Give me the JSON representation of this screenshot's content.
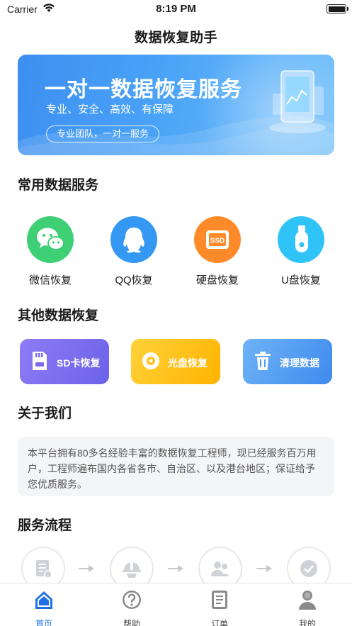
{
  "status_bar": {
    "carrier": "Carrier",
    "time": "8:19 PM"
  },
  "nav": {
    "title": "数据恢复助手"
  },
  "banner": {
    "title": "一对一数据恢复服务",
    "subtitle": "专业、安全、高效、有保障",
    "pill": "专业团队，一对一服务"
  },
  "common_services": {
    "title": "常用数据服务",
    "items": [
      {
        "label": "微信恢复",
        "icon": "wechat-icon",
        "color": "#3fcf75"
      },
      {
        "label": "QQ恢复",
        "icon": "qq-icon",
        "color": "#3598f3"
      },
      {
        "label": "硬盘恢复",
        "icon": "ssd-icon",
        "color": "#ff8a2a"
      },
      {
        "label": "U盘恢复",
        "icon": "usb-drive-icon",
        "color": "#2fc3f7"
      }
    ]
  },
  "other_recovery": {
    "title": "其他数据恢复",
    "items": [
      {
        "label": "SD卡恢复",
        "icon": "sd-card-icon",
        "color": "#7b6bf0"
      },
      {
        "label": "光盘恢复",
        "icon": "disc-icon",
        "color": "#ffc21a"
      },
      {
        "label": "清理数据",
        "icon": "trash-icon",
        "color": "#4f9af2"
      }
    ]
  },
  "about": {
    "title": "关于我们",
    "text": "本平台拥有80多名经验丰富的数据恢复工程师，现已经服务百万用户，工程师遍布国内各省各市、自治区、以及港台地区；保证给予您优质服务。"
  },
  "process": {
    "title": "服务流程",
    "steps": [
      {
        "icon": "order-form-icon"
      },
      {
        "icon": "engineer-icon"
      },
      {
        "icon": "customer-service-icon"
      },
      {
        "icon": "checkmark-icon"
      }
    ]
  },
  "tabbar": {
    "items": [
      {
        "label": "首页",
        "icon": "home-icon",
        "active": true
      },
      {
        "label": "帮助",
        "icon": "help-icon",
        "active": false
      },
      {
        "label": "订单",
        "icon": "order-icon",
        "active": false
      },
      {
        "label": "我的",
        "icon": "profile-icon",
        "active": false
      }
    ]
  }
}
